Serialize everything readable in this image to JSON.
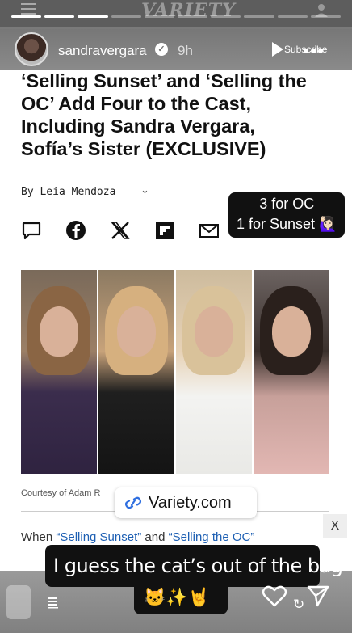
{
  "story": {
    "progress_segments": 10,
    "progress_completed": 3,
    "username": "sandravergara",
    "time_ago": "9h",
    "subscribe_label": "Subscribe"
  },
  "site": {
    "logo": "VARIETY"
  },
  "article": {
    "headline": "‘Selling Sunset’ and ‘Selling the OC’ Add Four to the Cast, Including Sandra Vergara, Sofía’s Sister (EXCLUSIVE)",
    "byline": "By Leia Mendoza",
    "courtesy": "Courtesy of Adam R",
    "next_para_prefix": "When ",
    "next_para_link1": "“Selling Sunset”",
    "next_para_mid": " and ",
    "next_para_link2": "“Selling the OC”",
    "share_icons": [
      "comment-icon",
      "facebook-icon",
      "x-icon",
      "flipboard-icon",
      "email-icon"
    ]
  },
  "stickers": {
    "counts_line1": "3 for OC",
    "counts_line2": "1 for Sunset 🙋🏻‍♀️",
    "link_text": "Variety.com",
    "caption": "I guess the cat’s out of the bag",
    "emojis": "🐱✨🤘"
  },
  "ui": {
    "close_label": "X"
  },
  "colors": {
    "link_blue": "#1d5fb3",
    "sticker_bg": "#111111"
  }
}
